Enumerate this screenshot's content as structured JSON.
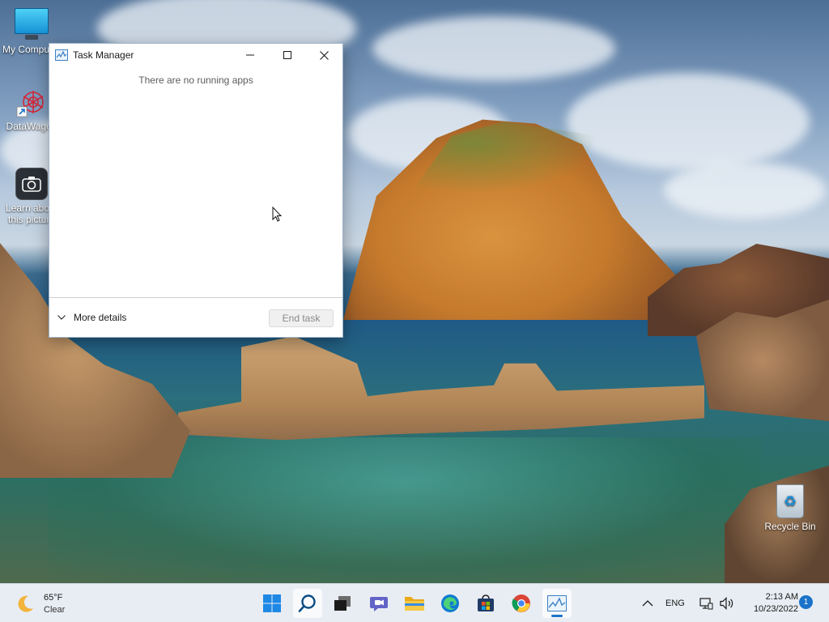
{
  "desktop": {
    "icons": [
      {
        "label": "My Computer",
        "icon": "monitor-icon"
      },
      {
        "label": "DataWagon",
        "icon": "datawagon-icon"
      },
      {
        "label": "Learn about this picture",
        "icon": "camera-icon"
      },
      {
        "label": "Recycle Bin",
        "icon": "recycle-bin-icon"
      }
    ]
  },
  "task_manager": {
    "title": "Task Manager",
    "empty_message": "There are no running apps",
    "more_details_label": "More details",
    "end_task_label": "End task"
  },
  "taskbar": {
    "weather": {
      "temperature": "65°F",
      "condition": "Clear"
    },
    "apps": [
      {
        "name": "Start",
        "icon": "windows-start-icon"
      },
      {
        "name": "Search",
        "icon": "search-icon"
      },
      {
        "name": "Task View",
        "icon": "task-view-icon"
      },
      {
        "name": "Chat",
        "icon": "chat-icon"
      },
      {
        "name": "File Explorer",
        "icon": "folder-icon"
      },
      {
        "name": "Microsoft Edge",
        "icon": "edge-icon"
      },
      {
        "name": "Microsoft Store",
        "icon": "store-icon"
      },
      {
        "name": "Google Chrome",
        "icon": "chrome-icon"
      },
      {
        "name": "Task Manager",
        "icon": "task-manager-icon"
      }
    ],
    "tray": {
      "language": "ENG",
      "time": "2:13 AM",
      "date": "10/23/2022",
      "notification_count": "1"
    }
  },
  "colors": {
    "accent": "#1a73c8",
    "taskbar_bg": "#e8edf3",
    "window_bg": "#ffffff"
  }
}
